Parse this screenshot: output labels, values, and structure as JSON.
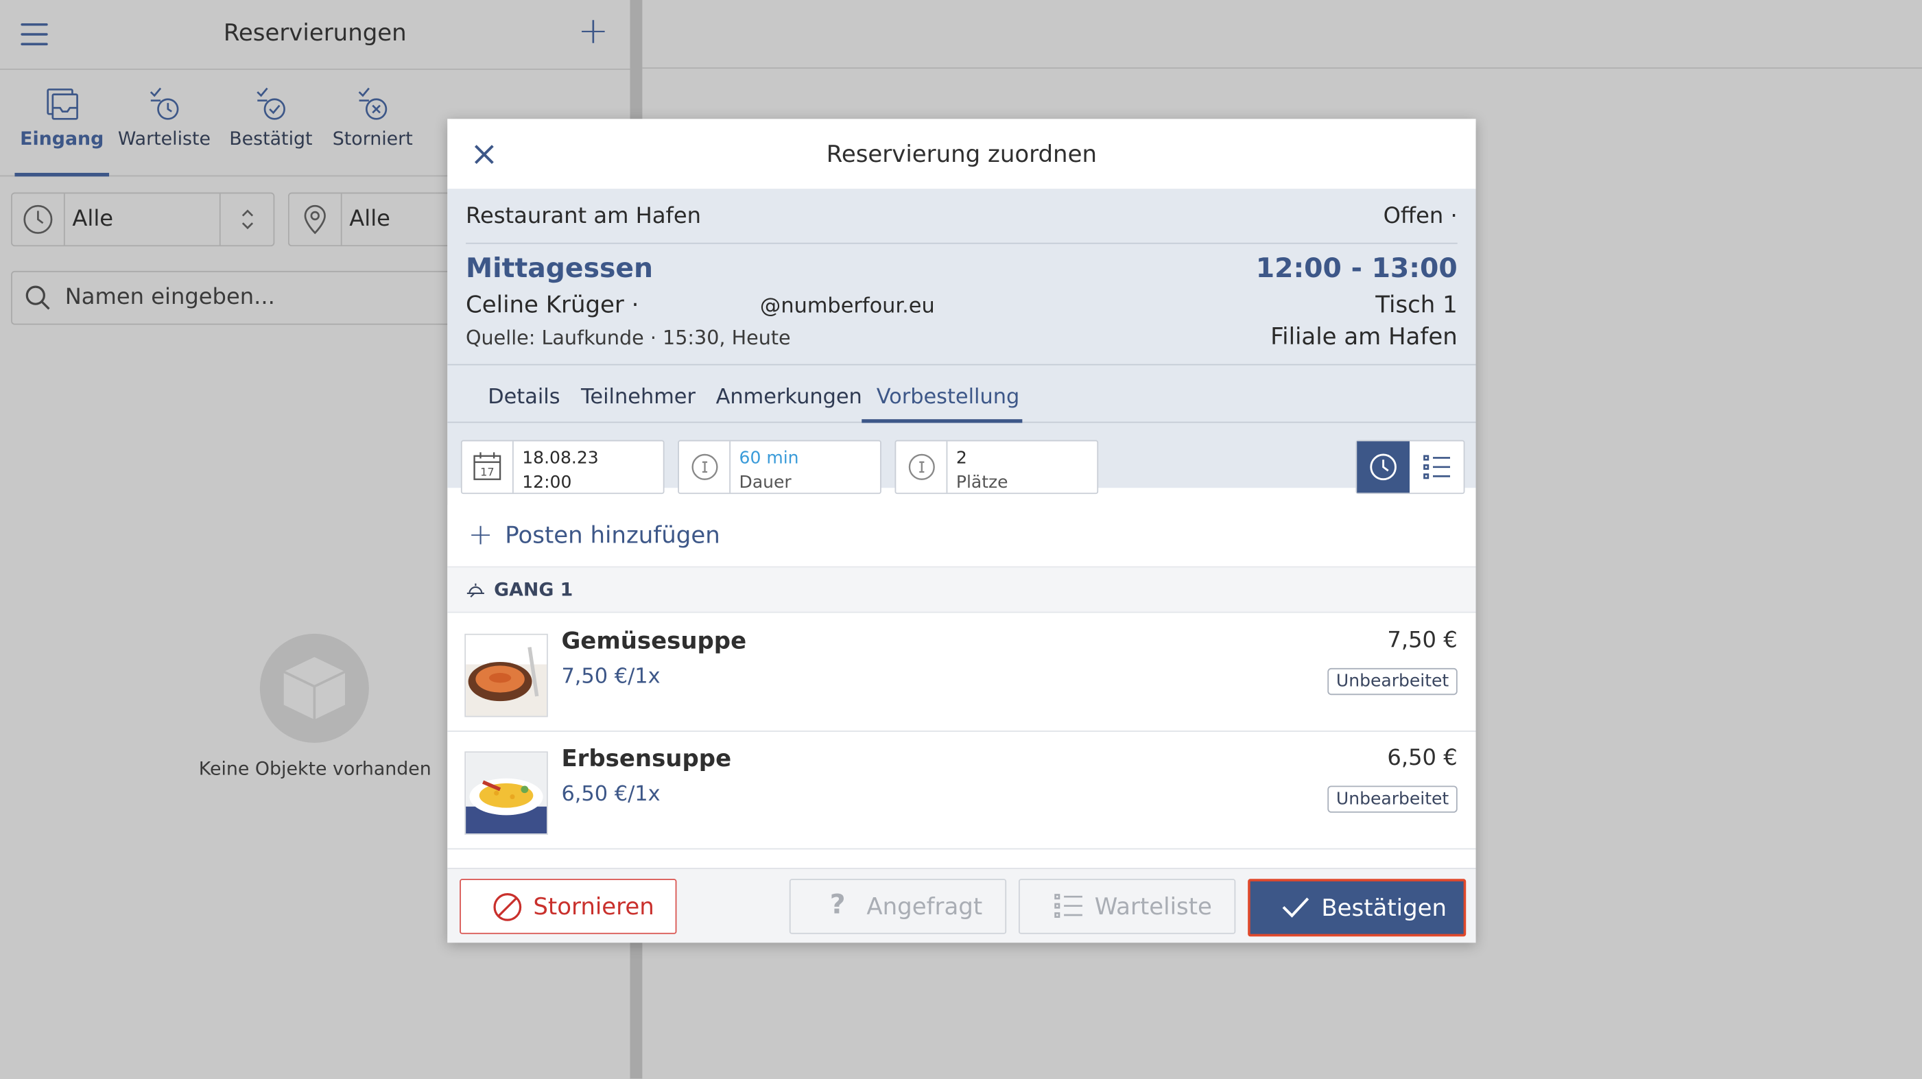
{
  "header": {
    "title": "Reservierungen",
    "menu_icon": "hamburger-menu-icon",
    "add_icon": "plus-icon"
  },
  "status_tabs": [
    {
      "label": "Eingang",
      "icon": "inbox-icon",
      "active": true
    },
    {
      "label": "Warteliste",
      "icon": "waitlist-clock-icon",
      "active": false
    },
    {
      "label": "Bestätigt",
      "icon": "confirmed-check-icon",
      "active": false
    },
    {
      "label": "Storniert",
      "icon": "cancelled-x-icon",
      "active": false
    }
  ],
  "filters": {
    "time": "Alle",
    "location": "Alle"
  },
  "search": {
    "placeholder": "Namen eingeben..."
  },
  "empty_state": {
    "text": "Keine Objekte vorhanden",
    "icon": "box-icon"
  },
  "modal": {
    "title": "Reservierung zuordnen",
    "restaurant": "Restaurant am Hafen",
    "status": "Offen ·",
    "meal": "Mittagessen",
    "time_range": "12:00 - 13:00",
    "guest": "Celine Krüger ·",
    "email": "@numberfour.eu",
    "table": "Tisch 1",
    "source": "Quelle: Laufkunde · 15:30, Heute",
    "branch": "Filiale am Hafen",
    "tabs": [
      "Details",
      "Teilnehmer",
      "Anmerkungen",
      "Vorbestellung"
    ],
    "active_tab": "Vorbestellung",
    "date_chip": {
      "line1": "18.08.23",
      "line2": "12:00"
    },
    "duration_chip": {
      "line1": "60 min",
      "line2": "Dauer"
    },
    "seats_chip": {
      "line1": "2",
      "line2": "Plätze"
    },
    "add_item_label": "Posten hinzufügen",
    "course_label": "GANG 1",
    "items": [
      {
        "name": "Gemüsesuppe",
        "unit_price": "7,50 €/1x",
        "price": "7,50 €",
        "status": "Unbearbeitet"
      },
      {
        "name": "Erbsensuppe",
        "unit_price": "6,50 €/1x",
        "price": "6,50 €",
        "status": "Unbearbeitet"
      }
    ],
    "buttons": {
      "cancel": "Stornieren",
      "requested": "Angefragt",
      "waitlist": "Warteliste",
      "confirm": "Bestätigen"
    }
  },
  "colors": {
    "accent": "#3d5788",
    "danger": "#c9302c",
    "highlight_border": "#e0492c",
    "backdrop": "#c8c8c8"
  }
}
